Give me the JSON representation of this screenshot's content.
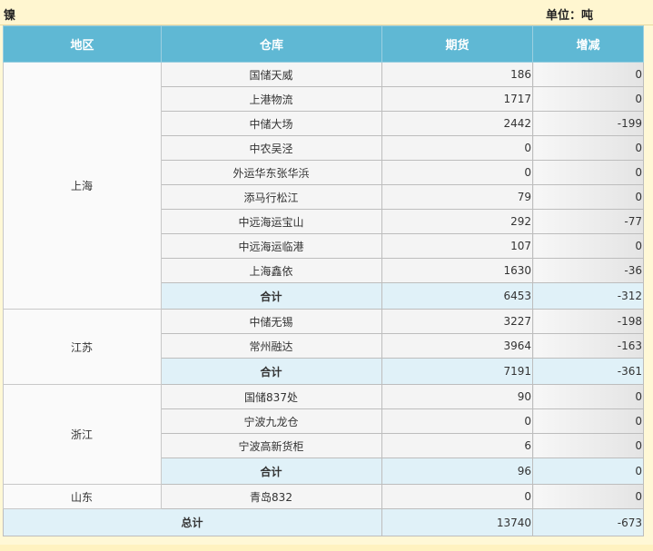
{
  "header": {
    "metal": "镍",
    "unit": "单位：吨"
  },
  "columns": {
    "region": "地区",
    "warehouse": "仓库",
    "futures": "期货",
    "change": "增减"
  },
  "groups": [
    {
      "region": "上海",
      "rows": [
        {
          "warehouse": "国储天威",
          "futures": "186",
          "change": "0"
        },
        {
          "warehouse": "上港物流",
          "futures": "1717",
          "change": "0"
        },
        {
          "warehouse": "中储大场",
          "futures": "2442",
          "change": "-199"
        },
        {
          "warehouse": "中农吴泾",
          "futures": "0",
          "change": "0"
        },
        {
          "warehouse": "外运华东张华浜",
          "futures": "0",
          "change": "0"
        },
        {
          "warehouse": "添马行松江",
          "futures": "79",
          "change": "0"
        },
        {
          "warehouse": "中远海运宝山",
          "futures": "292",
          "change": "-77"
        },
        {
          "warehouse": "中远海运临港",
          "futures": "107",
          "change": "0"
        },
        {
          "warehouse": "上海鑫依",
          "futures": "1630",
          "change": "-36"
        }
      ],
      "subtotal": {
        "label": "合计",
        "futures": "6453",
        "change": "-312"
      }
    },
    {
      "region": "江苏",
      "rows": [
        {
          "warehouse": "中储无锡",
          "futures": "3227",
          "change": "-198"
        },
        {
          "warehouse": "常州融达",
          "futures": "3964",
          "change": "-163"
        }
      ],
      "subtotal": {
        "label": "合计",
        "futures": "7191",
        "change": "-361"
      }
    },
    {
      "region": "浙江",
      "rows": [
        {
          "warehouse": "国储837处",
          "futures": "90",
          "change": "0"
        },
        {
          "warehouse": "宁波九龙仓",
          "futures": "0",
          "change": "0"
        },
        {
          "warehouse": "宁波高新货柜",
          "futures": "6",
          "change": "0"
        }
      ],
      "subtotal": {
        "label": "合计",
        "futures": "96",
        "change": "0"
      }
    },
    {
      "region": "山东",
      "rows": [
        {
          "warehouse": "青岛832",
          "futures": "0",
          "change": "0"
        }
      ],
      "subtotal": null
    }
  ],
  "total": {
    "label": "总计",
    "futures": "13740",
    "change": "-673"
  }
}
